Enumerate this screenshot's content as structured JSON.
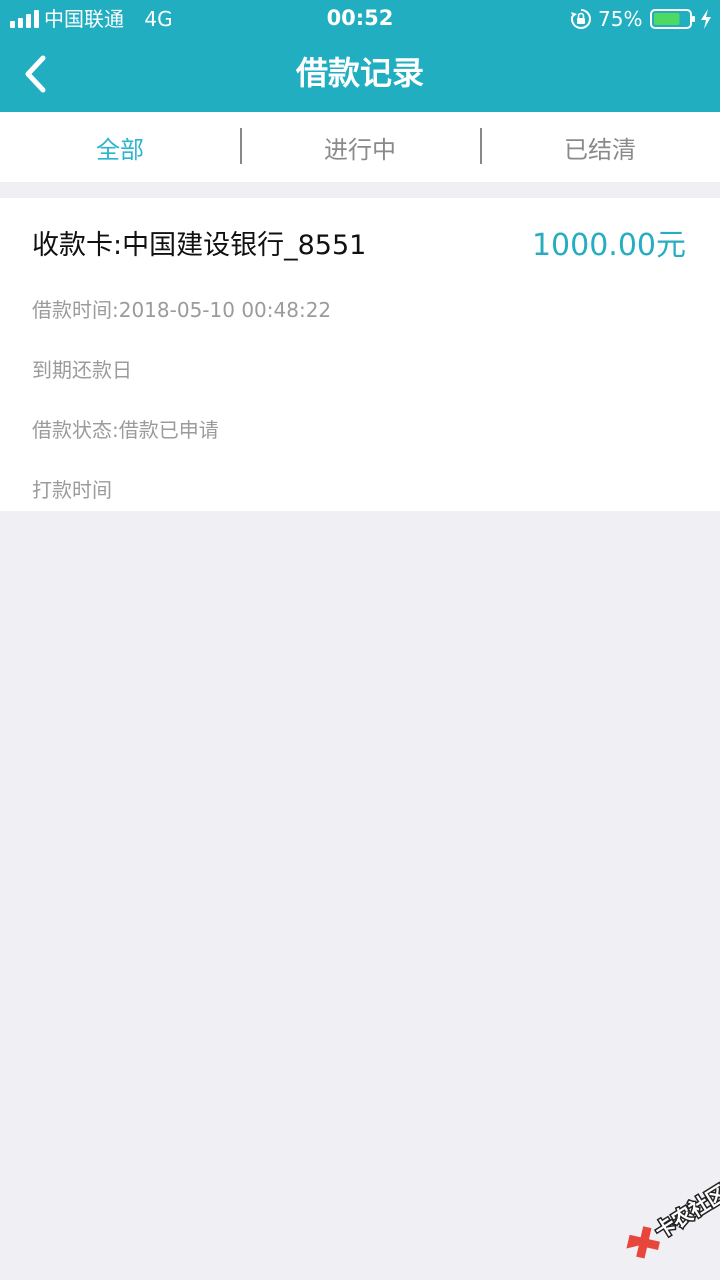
{
  "status_bar": {
    "carrier": "中国联通",
    "network": "4G",
    "time": "00:52",
    "battery_percent": "75%",
    "battery_level": 0.75
  },
  "nav": {
    "title": "借款记录",
    "back_icon": "chevron-left-icon"
  },
  "tabs": [
    {
      "label": "全部",
      "active": true
    },
    {
      "label": "进行中",
      "active": false
    },
    {
      "label": "已结清",
      "active": false
    }
  ],
  "record": {
    "receiving_card": "收款卡:中国建设银行_8551",
    "amount": "1000.00元",
    "loan_time": "借款时间:2018-05-10 00:48:22",
    "due_date": "到期还款日",
    "status": "借款状态:借款已申请",
    "payment_time": "打款时间"
  },
  "watermark": {
    "text": "卡农社区"
  },
  "colors": {
    "header_bg": "#21aec1",
    "accent": "#2cb5d0",
    "page_bg": "#efeff4"
  }
}
